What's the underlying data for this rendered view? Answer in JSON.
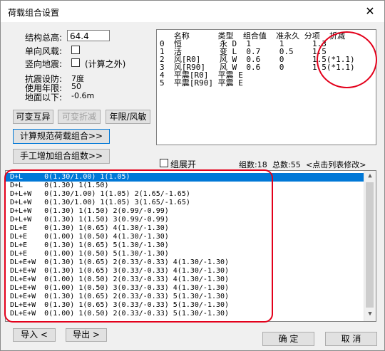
{
  "window": {
    "title": "荷载组合设置",
    "close_symbol": "✕"
  },
  "params": {
    "height_label": "结构总高:",
    "height_value": "64.4",
    "single_wind_label": "单向风载:",
    "vertical_quake_label": "竖向地震:",
    "vertical_quake_note": "(计算之外)",
    "quake_level_label": "抗震设防:",
    "quake_level_value": "7度",
    "service_life_label": "使用年限:",
    "service_life_value": "50",
    "underground_label": "地面以下:",
    "underground_value": "-0.6m"
  },
  "buttons": {
    "variable_mutual": "可变互异",
    "variable_reduce": "可变折减",
    "year_wind": "年限/风敏",
    "code_combo": "计算规范荷载组合>>",
    "manual_add": "手工增加组合组数>>",
    "import": "导入 <",
    "export": "导出 >",
    "ok": "确 定",
    "cancel": "取 消"
  },
  "load_table": {
    "header": "   名称      类型  组合值  准永久 分项  折减",
    "rows": [
      "0  恒        永 D  1      1      1.3",
      "1  活        变 L  0.7    0.5    1.5",
      "2  风[R0]    风 W  0.6    0      1.5(*1.1)",
      "3  风[R90]   风 W  0.6    0      1.5(*1.1)",
      "4  平震[R0]  平震 E",
      "5  平震[R90] 平震 E"
    ]
  },
  "group_expand_label": "组展开",
  "summary": {
    "groups": "组数:18",
    "total": "总数:55",
    "hint": "<点击列表修改>"
  },
  "combos": [
    "D+L     0(1.30/1.00) 1(1.05)",
    "D+L     0(1.30) 1(1.50)",
    "D+L+W   0(1.30/1.00) 1(1.05) 2(1.65/-1.65)",
    "D+L+W   0(1.30/1.00) 1(1.05) 3(1.65/-1.65)",
    "D+L+W   0(1.30) 1(1.50) 2(0.99/-0.99)",
    "D+L+W   0(1.30) 1(1.50) 3(0.99/-0.99)",
    "DL+E    0(1.30) 1(0.65) 4(1.30/-1.30)",
    "DL+E    0(1.00) 1(0.50) 4(1.30/-1.30)",
    "DL+E    0(1.30) 1(0.65) 5(1.30/-1.30)",
    "DL+E    0(1.00) 1(0.50) 5(1.30/-1.30)",
    "DL+E+W  0(1.30) 1(0.65) 2(0.33/-0.33) 4(1.30/-1.30)",
    "DL+E+W  0(1.30) 1(0.65) 3(0.33/-0.33) 4(1.30/-1.30)",
    "DL+E+W  0(1.00) 1(0.50) 2(0.33/-0.33) 4(1.30/-1.30)",
    "DL+E+W  0(1.00) 1(0.50) 3(0.33/-0.33) 4(1.30/-1.30)",
    "DL+E+W  0(1.30) 1(0.65) 2(0.33/-0.33) 5(1.30/-1.30)",
    "DL+E+W  0(1.30) 1(0.65) 3(0.33/-0.33) 5(1.30/-1.30)",
    "DL+E+W  0(1.00) 1(0.50) 2(0.33/-0.33) 5(1.30/-1.30)"
  ],
  "colors": {
    "selection": "#0078d7",
    "annotation": "#e3001b"
  },
  "icons": {
    "scroll_up": "▲",
    "scroll_down": "▼"
  }
}
